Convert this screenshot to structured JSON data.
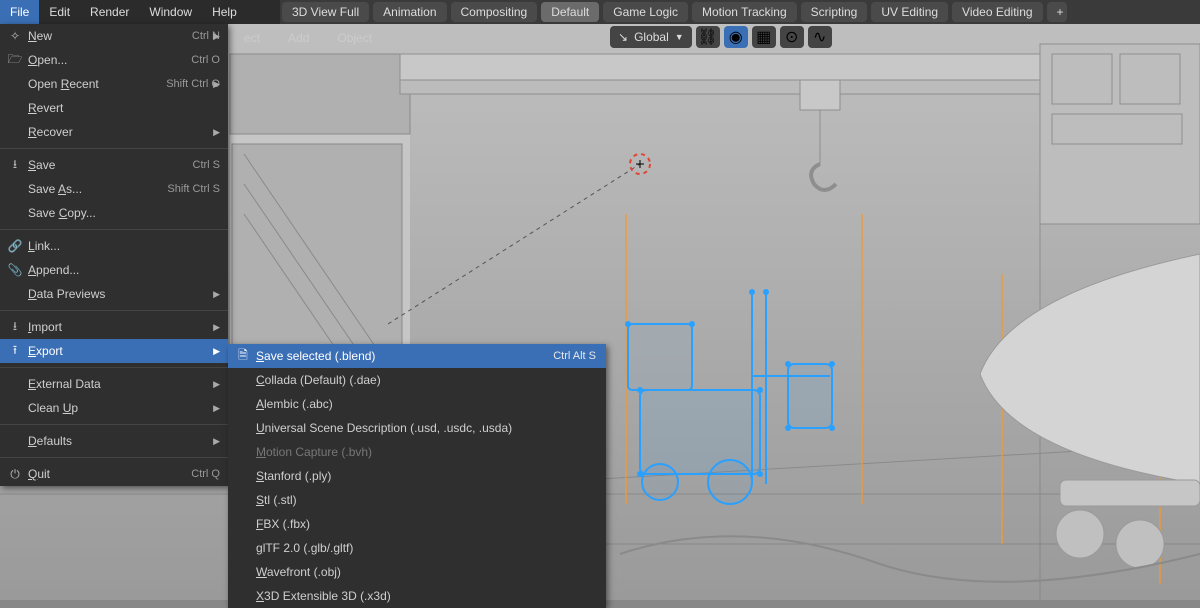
{
  "menubar": {
    "items": [
      "File",
      "Edit",
      "Render",
      "Window",
      "Help"
    ],
    "active_index": 0
  },
  "layout_tabs": {
    "items": [
      "3D View Full",
      "Animation",
      "Compositing",
      "Default",
      "Game Logic",
      "Motion Tracking",
      "Scripting",
      "UV Editing",
      "Video Editing"
    ],
    "active_index": 3,
    "plus": "+"
  },
  "toolbar2": {
    "items": [
      "ect",
      "Add",
      "Object"
    ]
  },
  "orientation": {
    "label": "Global",
    "icons": [
      "axes-icon",
      "link-icon",
      "snap-icon",
      "grid-icon",
      "magnet-icon",
      "curve-icon"
    ]
  },
  "file_menu": {
    "groups": [
      [
        {
          "icon": "✧",
          "label": "New",
          "u": 0,
          "shortcut": "Ctrl N",
          "arr": true
        },
        {
          "icon": "🗁",
          "label": "Open...",
          "u": 0,
          "shortcut": "Ctrl O"
        },
        {
          "icon": "",
          "label": "Open Recent",
          "u": 5,
          "shortcut": "Shift Ctrl O",
          "arr": true
        },
        {
          "icon": "",
          "label": "Revert",
          "u": 0
        },
        {
          "icon": "",
          "label": "Recover",
          "u": 0,
          "arr": true
        }
      ],
      [
        {
          "icon": "⭳",
          "label": "Save",
          "u": 0,
          "shortcut": "Ctrl S"
        },
        {
          "icon": "",
          "label": "Save As...",
          "u": 5,
          "shortcut": "Shift Ctrl S"
        },
        {
          "icon": "",
          "label": "Save Copy...",
          "u": 5
        }
      ],
      [
        {
          "icon": "🔗",
          "label": "Link...",
          "u": 0
        },
        {
          "icon": "📎",
          "label": "Append...",
          "u": 0
        },
        {
          "icon": "",
          "label": "Data Previews",
          "u": 0,
          "arr": true
        }
      ],
      [
        {
          "icon": "⭳",
          "label": "Import",
          "u": 0,
          "arr": true
        },
        {
          "icon": "⭱",
          "label": "Export",
          "u": 0,
          "arr": true,
          "highlight": true
        }
      ],
      [
        {
          "icon": "",
          "label": "External Data",
          "u": 0,
          "arr": true
        },
        {
          "icon": "",
          "label": "Clean Up",
          "u": 6,
          "arr": true
        }
      ],
      [
        {
          "icon": "",
          "label": "Defaults",
          "u": 0,
          "arr": true
        }
      ],
      [
        {
          "icon": "⏻",
          "label": "Quit",
          "u": 0,
          "shortcut": "Ctrl Q"
        }
      ]
    ]
  },
  "export_submenu": {
    "items": [
      {
        "icon": "🗎",
        "label": "Save selected (.blend)",
        "u": 0,
        "shortcut": "Ctrl Alt S",
        "highlight": true
      },
      {
        "label": "Collada (Default) (.dae)",
        "u": 0
      },
      {
        "label": "Alembic (.abc)",
        "u": 0
      },
      {
        "label": "Universal Scene Description (.usd, .usdc, .usda)",
        "u": 0
      },
      {
        "label": "Motion Capture (.bvh)",
        "u": 0,
        "disabled": true
      },
      {
        "label": "Stanford (.ply)",
        "u": 0
      },
      {
        "label": "Stl (.stl)",
        "u": 0
      },
      {
        "label": "FBX (.fbx)",
        "u": 0
      },
      {
        "label": "glTF 2.0 (.glb/.gltf)",
        "u": 0
      },
      {
        "label": "Wavefront (.obj)",
        "u": 0
      },
      {
        "label": "X3D Extensible 3D (.x3d)",
        "u": 0
      }
    ]
  },
  "colors": {
    "highlight": "#3b6fb5",
    "selection_outline": "#2aa0ff",
    "axis_orange": "#f59a2e"
  }
}
